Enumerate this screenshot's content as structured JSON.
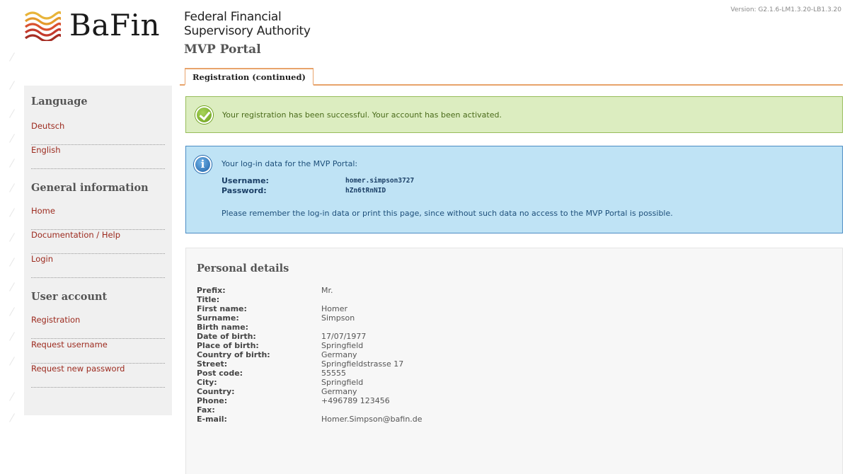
{
  "header": {
    "logo_text": "BaFin",
    "authority_line1": "Federal Financial",
    "authority_line2": "Supervisory Authority",
    "portal": "MVP Portal",
    "version": "Version: G2.1.6-LM1.3.20-LB1.3.20"
  },
  "tab": {
    "label": "Registration (continued)"
  },
  "sidebar": {
    "language_heading": "Language",
    "language_items": [
      "Deutsch",
      "English"
    ],
    "general_heading": "General information",
    "general_items": [
      "Home",
      "Documentation / Help",
      "Login"
    ],
    "account_heading": "User account",
    "account_items": [
      "Registration",
      "Request username",
      "Request new password"
    ]
  },
  "success": {
    "message": "Your registration has been successful. Your account has been activated."
  },
  "info": {
    "intro": "Your log-in data for the MVP Portal:",
    "username_label": "Username:",
    "username_value": "homer.simpson3727",
    "password_label": "Password:",
    "password_value": "hZn6tRnNID",
    "note": "Please remember the log-in data or print this page, since without such data no access to the MVP Portal is possible."
  },
  "details": {
    "heading": "Personal details",
    "rows": [
      {
        "label": "Prefix:",
        "value": "Mr."
      },
      {
        "label": "Title:",
        "value": ""
      },
      {
        "label": "First name:",
        "value": "Homer"
      },
      {
        "label": "Surname:",
        "value": "Simpson"
      },
      {
        "label": "Birth name:",
        "value": ""
      },
      {
        "label": "Date of birth:",
        "value": "17/07/1977"
      },
      {
        "label": "Place of birth:",
        "value": "Springfield"
      },
      {
        "label": "Country of birth:",
        "value": "Germany"
      },
      {
        "label": "Street:",
        "value": "Springfieldstrasse 17"
      },
      {
        "label": "Post code:",
        "value": "55555"
      },
      {
        "label": "City:",
        "value": "Springfield"
      },
      {
        "label": "Country:",
        "value": "Germany"
      },
      {
        "label": "Phone:",
        "value": "+496789 123456"
      },
      {
        "label": "Fax:",
        "value": ""
      },
      {
        "label": "E-mail:",
        "value": "Homer.Simpson@bafin.de"
      }
    ]
  },
  "colors": {
    "accent": "#e8a36b",
    "link": "#9c2a1e",
    "success_bg": "#dcedc0",
    "info_bg": "#bfe3f5"
  },
  "icons": {
    "logo": "bafin-wave-logo-icon",
    "success": "checkmark-circle-icon",
    "info": "info-circle-icon"
  }
}
